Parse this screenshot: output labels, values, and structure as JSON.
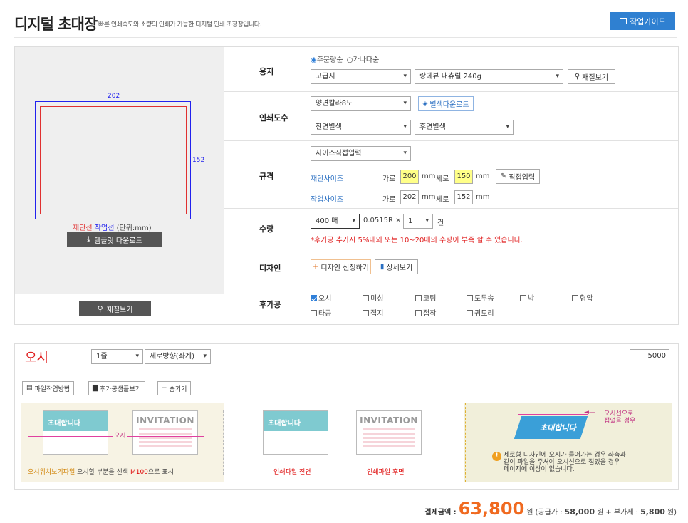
{
  "header": {
    "title": "디지털 초대장",
    "subtitle": "빠른 인쇄속도와 소량의 인쇄가 가능한 디지털 인쇄 초청장입니다.",
    "guide_button": "작업가이드"
  },
  "preview": {
    "width_label": "202",
    "height_label": "152",
    "legend_cut": "재단선",
    "legend_work": "작업선",
    "legend_unit": "(단위:mm)",
    "template_button": "템플릿 다운로드",
    "material_button": "재질보기"
  },
  "paper": {
    "label": "용지",
    "radio1": "주문량순",
    "radio2": "가나다순",
    "type": "고급지",
    "stock": "랑데뷰 내츄럴 240g",
    "view_button": "재질보기"
  },
  "colors": {
    "label": "인쇄도수",
    "mode": "양면칼라8도",
    "download_button": "별색다운로드",
    "front": "전면별색",
    "back": "후면별색"
  },
  "size": {
    "label": "규격",
    "mode": "사이즈직접입력",
    "cut_label": "재단사이즈",
    "work_label": "작업사이즈",
    "garo": "가로",
    "sero": "세로",
    "unit": "mm",
    "cut_w": "200",
    "cut_h": "150",
    "work_w": "202",
    "work_h": "152",
    "direct_button": "직접입력"
  },
  "quantity": {
    "label": "수량",
    "count": "400 매",
    "per": "0.0515R ×",
    "sets": "1",
    "unit": "건",
    "notice": "*후가공 추가시 5%내외 또는 10~20매의 수량이 부족 할 수 있습니다."
  },
  "design": {
    "label": "디자인",
    "apply_button": "디자인 신청하기",
    "detail_button": "상세보기"
  },
  "finishing": {
    "label": "후가공",
    "items": [
      "오시",
      "미싱",
      "코팅",
      "도무송",
      "박",
      "형압",
      "타공",
      "접지",
      "접착",
      "귀도리"
    ],
    "checked": [
      true,
      false,
      false,
      false,
      false,
      false,
      false,
      false,
      false,
      false
    ]
  },
  "osi": {
    "title": "오시",
    "lines": "1줄",
    "direction": "세로방향(좌계)",
    "value": "5000",
    "method_button": "파일작업방법",
    "sample_button": "후가공샘플보기",
    "hide_button": "숨기기",
    "card_text": "초대합니다",
    "card_invitation": "INVITATION",
    "osi_mark": "오시",
    "caption1_link": "오시위치보기파일",
    "caption1_rest": "오시할 부분을 선색 ",
    "caption1_m": "M100",
    "caption1_end": "으로 표시",
    "caption_front": "인쇄파일 전면",
    "caption_back": "인쇄파일 후면",
    "fold_label1": "오시선으로",
    "fold_label2": "접었을 경우",
    "fold_card": "초대합니다",
    "note1": "세로형 디자인에 오시가 들어가는 경우 좌측과",
    "note2": "같이 파일을 주셔야 오시선으로 접었을 경우",
    "note3": "페이지에 이상이 없습니다."
  },
  "payment": {
    "label": "결제금액 :",
    "amount": "63,800",
    "won": "원",
    "detail_pre": "(공급가 : ",
    "supply": "58,000",
    "detail_mid": "원 + 부가세 : ",
    "vat": "5,800",
    "detail_end": "원)"
  }
}
